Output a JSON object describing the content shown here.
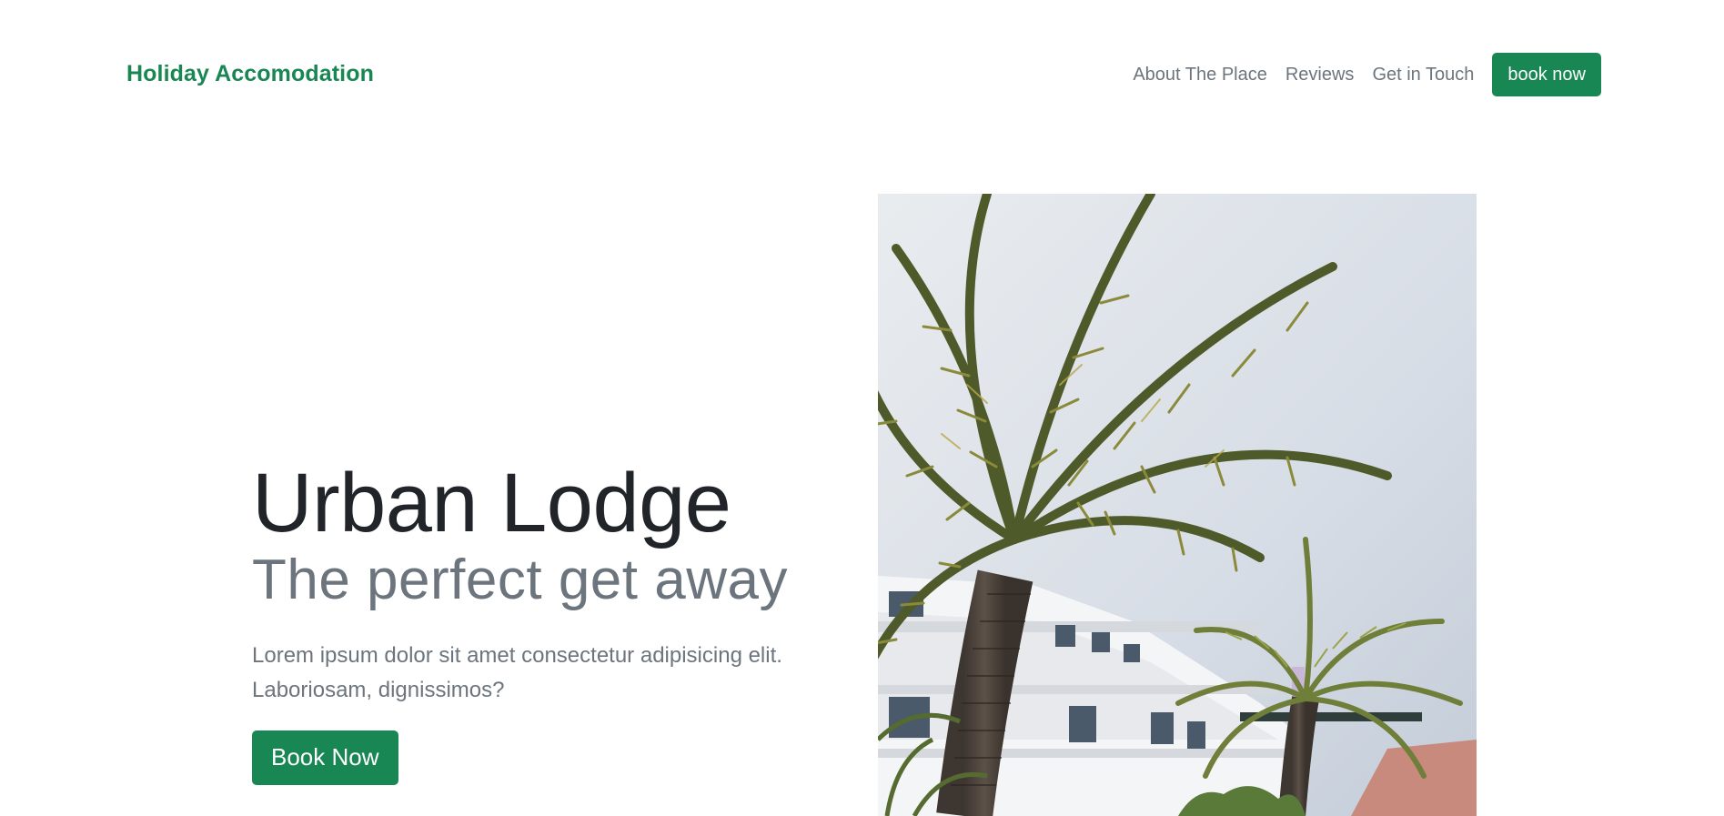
{
  "navbar": {
    "brand": "Holiday Accomodation",
    "links": [
      {
        "label": "About The Place"
      },
      {
        "label": "Reviews"
      },
      {
        "label": "Get in Touch"
      }
    ],
    "cta_label": "book now"
  },
  "hero": {
    "title": "Urban Lodge",
    "subtitle": "The perfect get away",
    "lead": "Lorem ipsum dolor sit amet consectetur adipisicing elit. Laboriosam, dignissimos?",
    "button_label": "Book Now"
  },
  "colors": {
    "brand_green": "#198754",
    "muted_text": "#6c757d",
    "dark_text": "#212529"
  }
}
